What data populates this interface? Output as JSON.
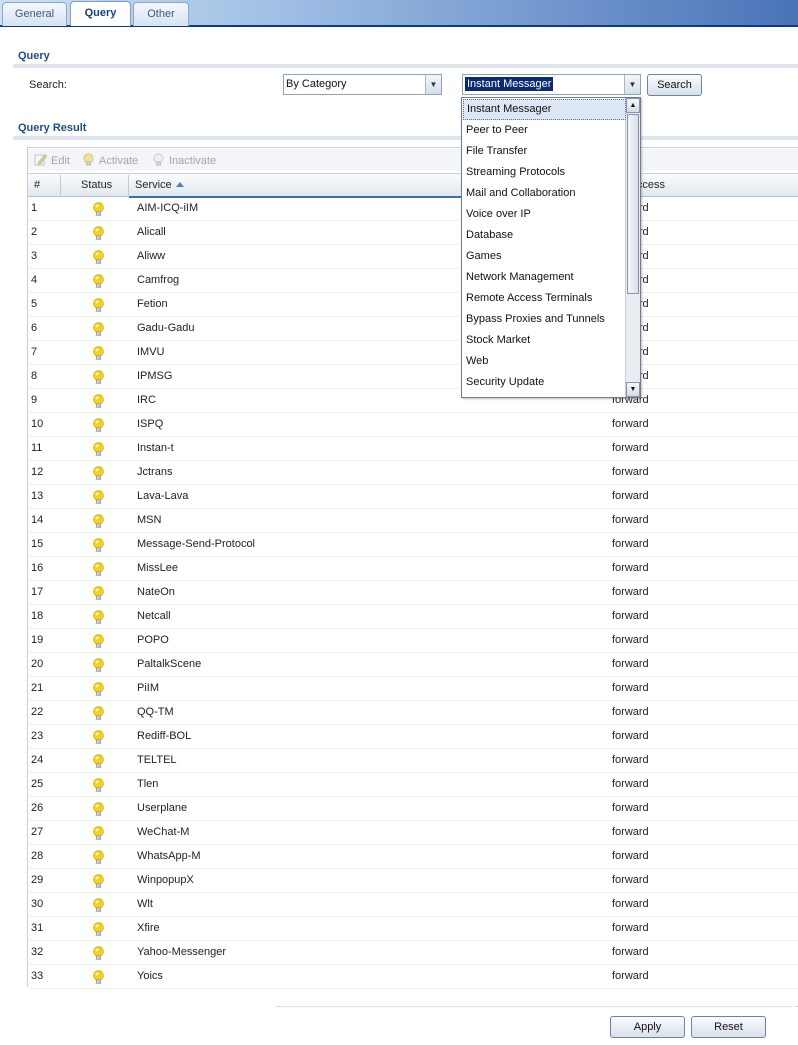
{
  "tabs": [
    {
      "label": "General",
      "active": false
    },
    {
      "label": "Query",
      "active": true
    },
    {
      "label": "Other",
      "active": false
    }
  ],
  "query": {
    "title": "Query",
    "search_label": "Search:",
    "search_by": "By Category",
    "category_value": "Instant Messager",
    "search_button": "Search"
  },
  "dropdown": {
    "options": [
      "Instant Messager",
      "Peer to Peer",
      "File Transfer",
      "Streaming Protocols",
      "Mail and Collaboration",
      "Voice over IP",
      "Database",
      "Games",
      "Network Management",
      "Remote Access Terminals",
      "Bypass Proxies and Tunnels",
      "Stock Market",
      "Web",
      "Security Update"
    ],
    "selected": "Instant Messager"
  },
  "result": {
    "title": "Query Result",
    "toolbar": {
      "edit": "Edit",
      "activate": "Activate",
      "inactivate": "Inactivate"
    },
    "columns": {
      "index": "#",
      "status": "Status",
      "service": "Service",
      "access": "Access"
    },
    "access_partial": "t Access",
    "rows": [
      {
        "n": "1",
        "service": "AIM-ICQ-iIM",
        "access": "forward"
      },
      {
        "n": "2",
        "service": "Alicall",
        "access": "forward"
      },
      {
        "n": "3",
        "service": "Aliww",
        "access": "forward"
      },
      {
        "n": "4",
        "service": "Camfrog",
        "access": "forward"
      },
      {
        "n": "5",
        "service": "Fetion",
        "access": "forward"
      },
      {
        "n": "6",
        "service": "Gadu-Gadu",
        "access": "forward"
      },
      {
        "n": "7",
        "service": "IMVU",
        "access": "forward"
      },
      {
        "n": "8",
        "service": "IPMSG",
        "access": "forward"
      },
      {
        "n": "9",
        "service": "IRC",
        "access": "forward"
      },
      {
        "n": "10",
        "service": "ISPQ",
        "access": "forward"
      },
      {
        "n": "11",
        "service": "Instan-t",
        "access": "forward"
      },
      {
        "n": "12",
        "service": "Jctrans",
        "access": "forward"
      },
      {
        "n": "13",
        "service": "Lava-Lava",
        "access": "forward"
      },
      {
        "n": "14",
        "service": "MSN",
        "access": "forward"
      },
      {
        "n": "15",
        "service": "Message-Send-Protocol",
        "access": "forward"
      },
      {
        "n": "16",
        "service": "MissLee",
        "access": "forward"
      },
      {
        "n": "17",
        "service": "NateOn",
        "access": "forward"
      },
      {
        "n": "18",
        "service": "Netcall",
        "access": "forward"
      },
      {
        "n": "19",
        "service": "POPO",
        "access": "forward"
      },
      {
        "n": "20",
        "service": "PaltalkScene",
        "access": "forward"
      },
      {
        "n": "21",
        "service": "PiIM",
        "access": "forward"
      },
      {
        "n": "22",
        "service": "QQ-TM",
        "access": "forward"
      },
      {
        "n": "23",
        "service": "Rediff-BOL",
        "access": "forward"
      },
      {
        "n": "24",
        "service": "TELTEL",
        "access": "forward"
      },
      {
        "n": "25",
        "service": "Tlen",
        "access": "forward"
      },
      {
        "n": "26",
        "service": "Userplane",
        "access": "forward"
      },
      {
        "n": "27",
        "service": "WeChat-M",
        "access": "forward"
      },
      {
        "n": "28",
        "service": "WhatsApp-M",
        "access": "forward"
      },
      {
        "n": "29",
        "service": "WinpopupX",
        "access": "forward"
      },
      {
        "n": "30",
        "service": "Wlt",
        "access": "forward"
      },
      {
        "n": "31",
        "service": "Xfire",
        "access": "forward"
      },
      {
        "n": "32",
        "service": "Yahoo-Messenger",
        "access": "forward"
      },
      {
        "n": "33",
        "service": "Yoics",
        "access": "forward"
      }
    ]
  },
  "footer": {
    "apply": "Apply",
    "reset": "Reset"
  },
  "colors": {
    "accent": "#1d4f8c",
    "selection": "#0a2a74",
    "bulb": "#f3d21b"
  },
  "icons": {
    "status": "lightbulb-icon",
    "edit": "edit-icon",
    "sort": "sort-ascending-icon"
  }
}
